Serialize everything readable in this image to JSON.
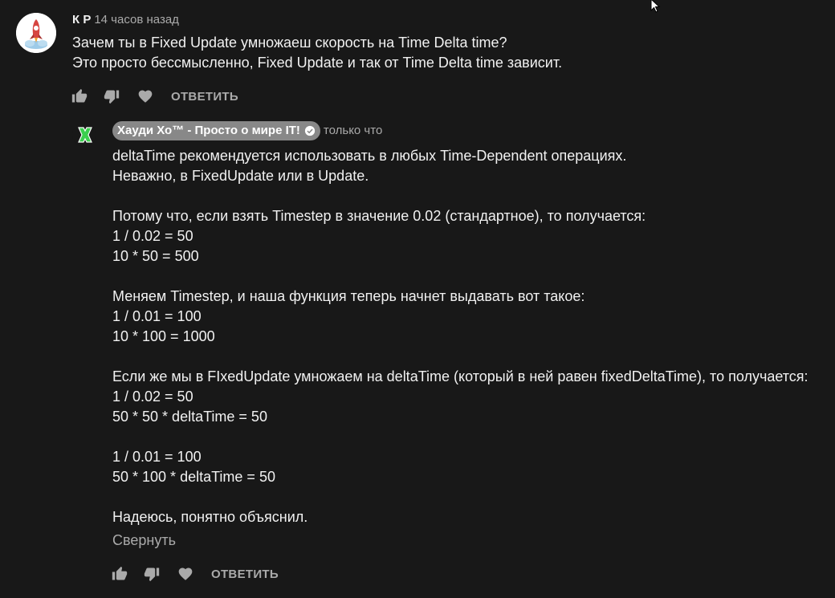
{
  "comment": {
    "author": "К Р",
    "time": "14 часов назад",
    "text": "Зачем ты в Fixed Update умножаеш скорость на Time Delta time?\nЭто просто бессмысленно, Fixed Update и так от Time Delta time зависит.",
    "reply_label": "ОТВЕТИТЬ"
  },
  "reply": {
    "author": "Хауди Хо™ - Просто о мире IT!",
    "time": "только что",
    "text": "deltaTime рекомендуется использовать в любых Time-Dependent операциях.\nНеважно, в FixedUpdate или в Update.\n\nПотому что, если взять Timestep в значение 0.02 (стандартное), то получается:\n1 / 0.02 = 50\n10 * 50 = 500\n\nМеняем Timestep, и наша функция теперь начнет выдавать вот такое:\n1 / 0.01 = 100\n10 * 100 = 1000\n\nЕсли же мы в FIxedUpdate умножаем на deltaTime (который в ней равен fixedDeltaTime), то получается:\n1 / 0.02 = 50\n50 * 50 * deltaTime = 50\n\n1 / 0.01 = 100\n50 * 100 * deltaTime = 50\n\nНадеюсь, понятно объяснил.",
    "collapse_label": "Свернуть",
    "reply_label": "ОТВЕТИТЬ"
  },
  "icons": {
    "like": "thumb-up-icon",
    "dislike": "thumb-down-icon",
    "heart": "heart-icon",
    "verified": "check-circle-icon",
    "cursor": "mouse-cursor-icon"
  },
  "colors": {
    "background": "#181818",
    "text": "#f1f1f1",
    "secondary": "#aaaaaa",
    "badge": "#888888"
  }
}
